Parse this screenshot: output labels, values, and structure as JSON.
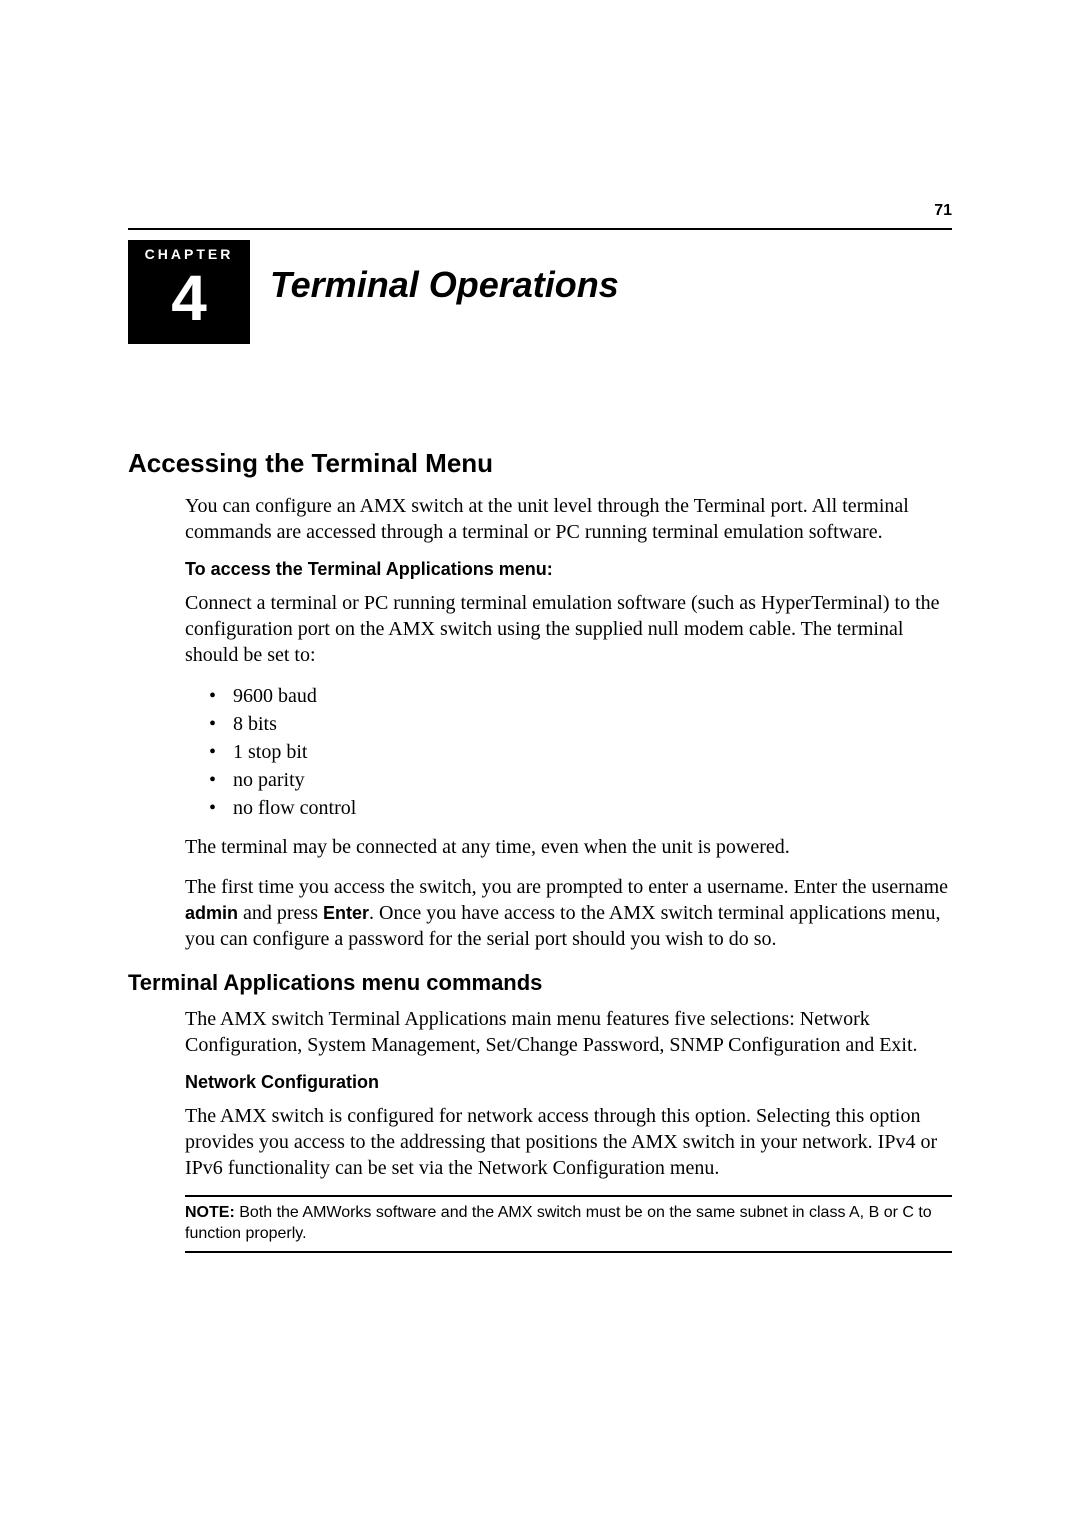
{
  "page_number": "71",
  "chapter": {
    "label": "CHAPTER",
    "number": "4",
    "title": "Terminal Operations"
  },
  "section": {
    "heading": "Accessing the Terminal Menu",
    "intro": "You can configure an AMX switch at the unit level through the Terminal port. All terminal commands are accessed through a terminal or PC running terminal emulation software.",
    "access_heading": "To access the Terminal Applications menu:",
    "access_text": "Connect a terminal or PC running terminal emulation software (such as HyperTerminal) to the configuration port on the AMX switch using the supplied null modem cable. The terminal should be set to:",
    "settings": [
      "9600 baud",
      "8 bits",
      "1 stop bit",
      "no parity",
      "no flow control"
    ],
    "terminal_connect": "The terminal may be connected at any time, even when the unit is powered.",
    "first_time_pre": "The first time you access the switch, you are prompted to enter a username. Enter the username ",
    "admin_word": "admin",
    "first_time_mid": " and press ",
    "enter_word": "Enter",
    "first_time_post": ". Once you have access to the AMX switch terminal applications menu, you can configure a password for the serial port should you wish to do so."
  },
  "subsection": {
    "heading": "Terminal Applications menu commands",
    "text": "The AMX switch Terminal Applications main menu features five selections: Network Configuration, System Management, Set/Change Password, SNMP Configuration and Exit.",
    "netconf_heading": "Network Configuration",
    "netconf_text": "The AMX switch is configured for network access through this option. Selecting this option provides you access to the addressing that positions the AMX switch in your network. IPv4 or IPv6 functionality can be set via the Network Configuration menu.",
    "note_label": "NOTE:",
    "note_text": " Both the AMWorks software and the AMX switch must be on the same subnet in class A, B or C to function properly."
  }
}
